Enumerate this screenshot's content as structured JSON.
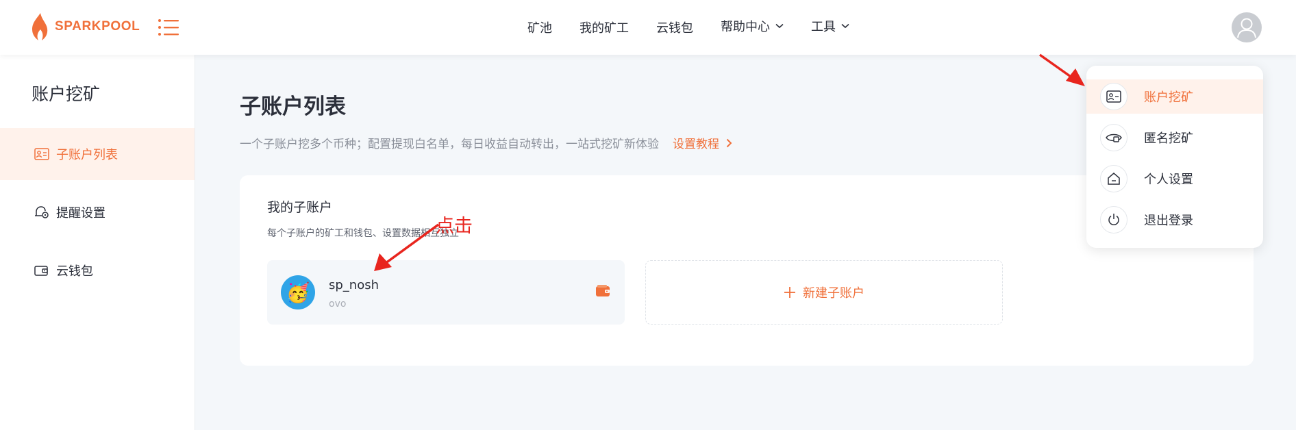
{
  "brand": {
    "name": "SPARKPOOL",
    "accent": "#f0703a"
  },
  "header": {
    "nav": [
      {
        "label": "矿池"
      },
      {
        "label": "我的矿工"
      },
      {
        "label": "云钱包"
      },
      {
        "label": "帮助中心",
        "has_dropdown": true
      },
      {
        "label": "工具",
        "has_dropdown": true
      }
    ]
  },
  "sidebar": {
    "title": "账户挖矿",
    "items": [
      {
        "label": "子账户列表",
        "icon": "id-card-icon",
        "active": true
      },
      {
        "label": "提醒设置",
        "icon": "bell-settings-icon",
        "active": false
      },
      {
        "label": "云钱包",
        "icon": "wallet-icon",
        "active": false
      }
    ]
  },
  "main": {
    "title": "子账户列表",
    "subtitle": "一个子账户挖多个币种；配置提现白名单，每日收益自动转出，一站式挖矿新体验",
    "tutorial_link": "设置教程",
    "card": {
      "title": "我的子账户",
      "subtitle": "每个子账户的矿工和钱包、设置数据相互独立",
      "accounts": [
        {
          "name": "sp_nosh",
          "note": "ovo",
          "avatar": "🥳"
        }
      ],
      "new_label": "新建子账户"
    }
  },
  "dropdown": {
    "items": [
      {
        "label": "账户挖矿",
        "icon": "id-card-icon",
        "active": true
      },
      {
        "label": "匿名挖矿",
        "icon": "anonymous-icon",
        "active": false
      },
      {
        "label": "个人设置",
        "icon": "home-icon",
        "active": false
      },
      {
        "label": "退出登录",
        "icon": "power-icon",
        "active": false
      }
    ]
  },
  "annotation": {
    "label": "点击",
    "color": "#e8251e"
  }
}
